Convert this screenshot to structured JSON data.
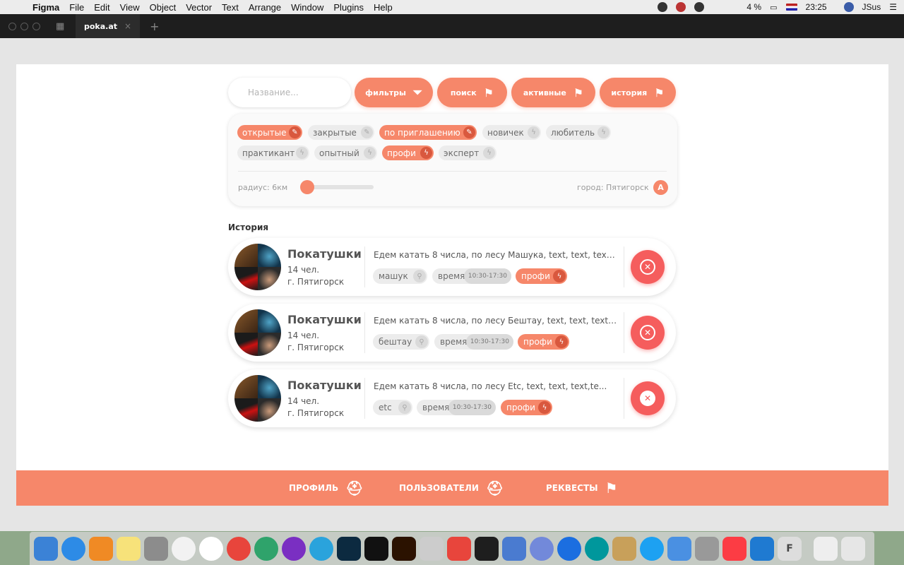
{
  "menubar": {
    "app": "Figma",
    "items": [
      "File",
      "Edit",
      "View",
      "Object",
      "Vector",
      "Text",
      "Arrange",
      "Window",
      "Plugins",
      "Help"
    ],
    "battery": "4 %",
    "time": "23:25",
    "user": "JSus"
  },
  "titlebar": {
    "tab_label": "poka.at",
    "tab_close": "×",
    "new_tab": "+"
  },
  "toolbar": {
    "search_placeholder": "Название...",
    "filters_label": "фильтры",
    "search_label": "поиск",
    "active_label": "активные",
    "history_label": "история"
  },
  "filters": {
    "chips": [
      {
        "label": "открытые",
        "on": true
      },
      {
        "label": "закрытые",
        "on": false
      },
      {
        "label": "по приглашению",
        "on": true
      },
      {
        "label": "новичек",
        "on": false
      },
      {
        "label": "любитель",
        "on": false
      },
      {
        "label": "практикант",
        "on": false
      },
      {
        "label": "опытный",
        "on": false
      },
      {
        "label": "профи",
        "on": true
      },
      {
        "label": "эксперт",
        "on": false
      }
    ],
    "radius_label": "радиус: 6км",
    "radius_level": 0.1,
    "city_label": "город: Пятигорск",
    "city_button": "A"
  },
  "history": {
    "title": "История",
    "rows": [
      {
        "name": "Покатушки",
        "count": "14 чел.",
        "city": "г. Пятигорск",
        "desc": "Едем катать 8 числа, по лесу Машука,  text, text, text,te...",
        "place": "машук",
        "time_label": "время",
        "time": "10:30-17:30",
        "level": "профи"
      },
      {
        "name": "Покатушки",
        "count": "14 чел.",
        "city": "г. Пятигорск",
        "desc": "Едем катать 8 числа, по лесу Бештау,  text, text, text, t...",
        "place": "бештау",
        "time_label": "время",
        "time": "10:30-17:30",
        "level": "профи"
      },
      {
        "name": "Покатушки",
        "count": "14 чел.",
        "city": "г. Пятигорск",
        "desc": "Едем катать 8 числа, по лесу Etc,  text, text, text,te...",
        "place": "etc",
        "time_label": "время",
        "time": "10:30-17:30",
        "level": "профи"
      }
    ]
  },
  "bottom_nav": {
    "profile": "ПРОФИЛЬ",
    "users": "ПОЛЬЗОВАТЕЛИ",
    "quests": "РЕКВЕСТЫ"
  },
  "colors": {
    "accent": "#f6876a",
    "accent_dark": "#d9583e",
    "danger": "#f55d5d",
    "chip_bg": "#ececec"
  }
}
